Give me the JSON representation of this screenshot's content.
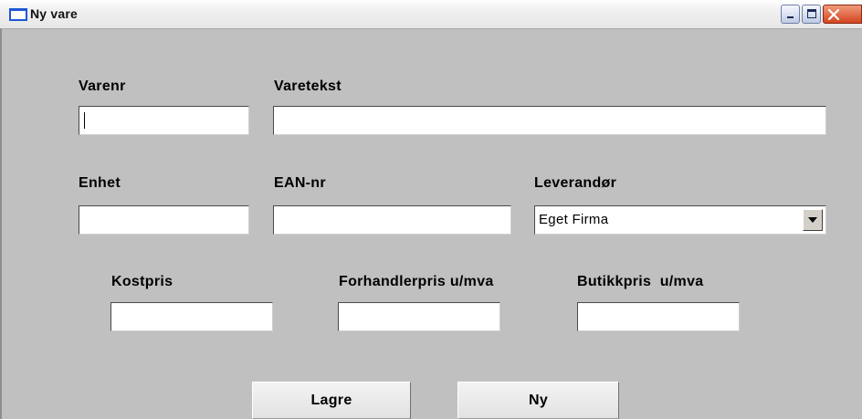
{
  "window": {
    "title": "Ny vare"
  },
  "row1": {
    "varenr": {
      "label": "Varenr",
      "value": ""
    },
    "varetekst": {
      "label": "Varetekst",
      "value": ""
    }
  },
  "row2": {
    "enhet": {
      "label": "Enhet",
      "value": ""
    },
    "ean": {
      "label": "EAN-nr",
      "value": ""
    },
    "leverandor": {
      "label": "Leverandør",
      "selected": "Eget Firma"
    }
  },
  "row3": {
    "kostpris": {
      "label": "Kostpris",
      "value": ""
    },
    "forhandlerpris": {
      "label": "Forhandlerpris u/mva",
      "value": ""
    },
    "butikkpris": {
      "label": "Butikkpris  u/mva",
      "value": ""
    }
  },
  "buttons": {
    "save": "Lagre",
    "new": "Ny"
  },
  "colors": {
    "window_bg": "#c0c0c0",
    "field_bg": "#ffffff",
    "close_red": "#d4441f",
    "icon_blue": "#1f57d6"
  }
}
